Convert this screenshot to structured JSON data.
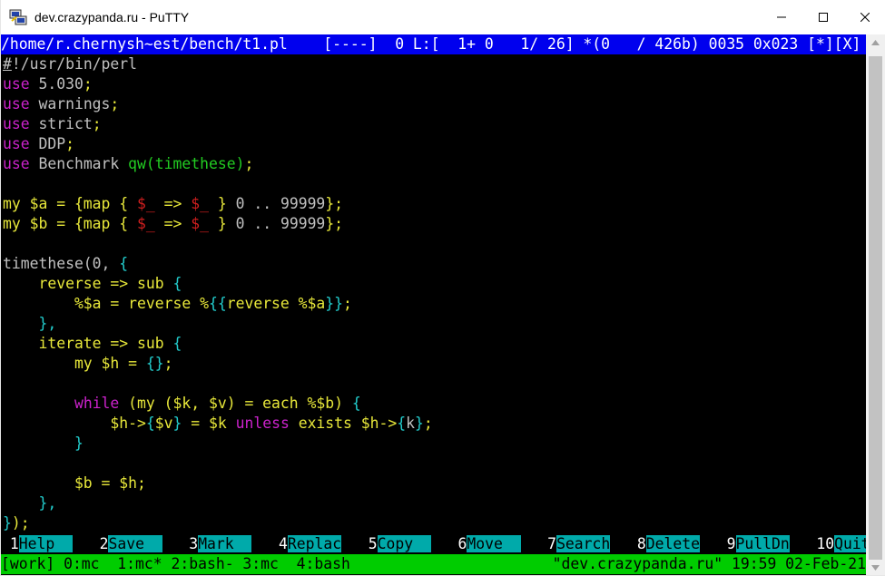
{
  "window": {
    "title": "dev.crazypanda.ru - PuTTY"
  },
  "colors": {
    "status_bg": "#0000ee",
    "tmux_bg": "#00cc00",
    "keyword": "#cc22cc",
    "variable": "#e8e83a",
    "var_special": "#d21f1f",
    "bracket": "#22cccc",
    "plain": "#c0c0c0",
    "string_green": "#22cc22"
  },
  "editor": {
    "status_path": "/home/r.chernysh~est/bench/t1.pl",
    "status_info": "    [----]  0 L:[  1+ 0   1/ 26] *(0   / 426b) 0035 0x023 [*][X]"
  },
  "code_lines": [
    [
      {
        "t": "#",
        "c": "plain",
        "u": true
      },
      {
        "t": "!/usr/bin/perl",
        "c": "plain"
      }
    ],
    [
      {
        "t": "use",
        "c": "keyword"
      },
      {
        "t": " 5.030",
        "c": "plain"
      },
      {
        "t": ";",
        "c": "variable"
      }
    ],
    [
      {
        "t": "use",
        "c": "keyword"
      },
      {
        "t": " warnings",
        "c": "plain"
      },
      {
        "t": ";",
        "c": "variable"
      }
    ],
    [
      {
        "t": "use",
        "c": "keyword"
      },
      {
        "t": " strict",
        "c": "plain"
      },
      {
        "t": ";",
        "c": "variable"
      }
    ],
    [
      {
        "t": "use",
        "c": "keyword"
      },
      {
        "t": " DDP",
        "c": "plain"
      },
      {
        "t": ";",
        "c": "variable"
      }
    ],
    [
      {
        "t": "use",
        "c": "keyword"
      },
      {
        "t": " Benchmark ",
        "c": "plain"
      },
      {
        "t": "qw(timethese)",
        "c": "string_green"
      },
      {
        "t": ";",
        "c": "variable"
      }
    ],
    [],
    [
      {
        "t": "my $a = {map { ",
        "c": "variable"
      },
      {
        "t": "$_",
        "c": "var_special"
      },
      {
        "t": " => ",
        "c": "variable"
      },
      {
        "t": "$_",
        "c": "var_special"
      },
      {
        "t": " } ",
        "c": "variable"
      },
      {
        "t": "0 .. 99999",
        "c": "plain"
      },
      {
        "t": "};",
        "c": "variable"
      }
    ],
    [
      {
        "t": "my $b = {map { ",
        "c": "variable"
      },
      {
        "t": "$_",
        "c": "var_special"
      },
      {
        "t": " => ",
        "c": "variable"
      },
      {
        "t": "$_",
        "c": "var_special"
      },
      {
        "t": " } ",
        "c": "variable"
      },
      {
        "t": "0 .. 99999",
        "c": "plain"
      },
      {
        "t": "};",
        "c": "variable"
      }
    ],
    [],
    [
      {
        "t": "timethese(0, ",
        "c": "plain"
      },
      {
        "t": "{",
        "c": "bracket"
      }
    ],
    [
      {
        "t": "    reverse => sub ",
        "c": "variable"
      },
      {
        "t": "{",
        "c": "bracket"
      }
    ],
    [
      {
        "t": "        %$a = reverse %",
        "c": "variable"
      },
      {
        "t": "{{",
        "c": "bracket"
      },
      {
        "t": "reverse %$a",
        "c": "variable"
      },
      {
        "t": "}}",
        "c": "bracket"
      },
      {
        "t": ";",
        "c": "variable"
      }
    ],
    [
      {
        "t": "    ",
        "c": "plain"
      },
      {
        "t": "},",
        "c": "bracket"
      }
    ],
    [
      {
        "t": "    iterate => sub ",
        "c": "variable"
      },
      {
        "t": "{",
        "c": "bracket"
      }
    ],
    [
      {
        "t": "        my $h = ",
        "c": "variable"
      },
      {
        "t": "{}",
        "c": "bracket"
      },
      {
        "t": ";",
        "c": "variable"
      }
    ],
    [],
    [
      {
        "t": "        ",
        "c": "plain"
      },
      {
        "t": "while",
        "c": "keyword"
      },
      {
        "t": " (my ($k, $v) = each %$b) ",
        "c": "variable"
      },
      {
        "t": "{",
        "c": "bracket"
      }
    ],
    [
      {
        "t": "            $h->",
        "c": "variable"
      },
      {
        "t": "{",
        "c": "bracket"
      },
      {
        "t": "$v",
        "c": "variable"
      },
      {
        "t": "}",
        "c": "bracket"
      },
      {
        "t": " = $k ",
        "c": "variable"
      },
      {
        "t": "unless",
        "c": "keyword"
      },
      {
        "t": " exists $h->",
        "c": "variable"
      },
      {
        "t": "{",
        "c": "bracket"
      },
      {
        "t": "k",
        "c": "plain"
      },
      {
        "t": "}",
        "c": "bracket"
      },
      {
        "t": ";",
        "c": "variable"
      }
    ],
    [
      {
        "t": "        ",
        "c": "plain"
      },
      {
        "t": "}",
        "c": "bracket"
      }
    ],
    [],
    [
      {
        "t": "        $b = $h;",
        "c": "variable"
      }
    ],
    [
      {
        "t": "    ",
        "c": "plain"
      },
      {
        "t": "},",
        "c": "bracket"
      }
    ],
    [
      {
        "t": "}",
        "c": "bracket"
      },
      {
        "t": ");",
        "c": "variable"
      }
    ]
  ],
  "keybar": [
    {
      "num": " 1",
      "label": "Help  "
    },
    {
      "num": " 2",
      "label": "Save  "
    },
    {
      "num": " 3",
      "label": "Mark  "
    },
    {
      "num": " 4",
      "label": "Replac"
    },
    {
      "num": " 5",
      "label": "Copy  "
    },
    {
      "num": " 6",
      "label": "Move  "
    },
    {
      "num": " 7",
      "label": "Search"
    },
    {
      "num": " 8",
      "label": "Delete"
    },
    {
      "num": " 9",
      "label": "PullDn"
    },
    {
      "num": " 10",
      "label": "Quit"
    }
  ],
  "tmux": {
    "left": "[work] 0:mc  1:mc* 2:bash- 3:mc  4:bash",
    "right": "\"dev.crazypanda.ru\" 19:59 02-Feb-21"
  },
  "scrollbar": {
    "position_fraction": 0.97
  }
}
